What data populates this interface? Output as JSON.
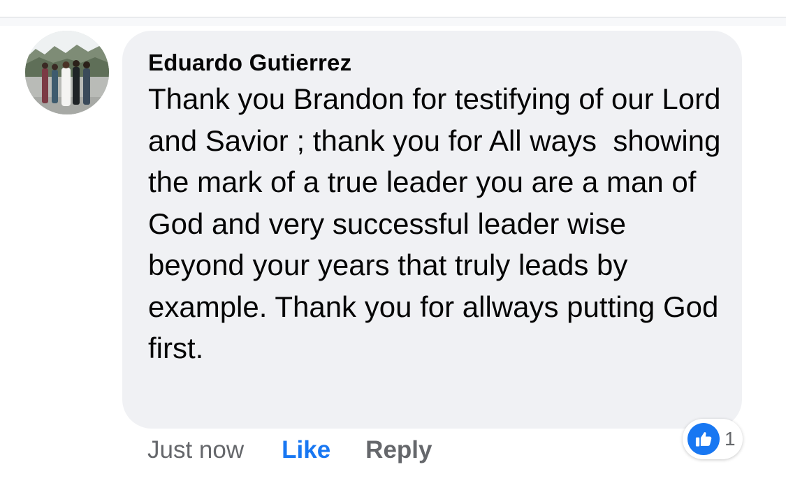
{
  "comment": {
    "author": "Eduardo Gutierrez",
    "text": "Thank you Brandon for testifying of our Lord and Savior ; thank you for All ways  showing the mark of a true leader you are a man of God and very successful leader wise beyond your years that truly leads by example. Thank you for allways putting God first.",
    "avatar_icon": "profile-photo-group"
  },
  "actions": {
    "timestamp": "Just now",
    "like_label": "Like",
    "reply_label": "Reply"
  },
  "reactions": {
    "icon": "thumbs-up-icon",
    "count": "1"
  },
  "colors": {
    "bubble_bg": "#f0f1f4",
    "like_blue": "#1877f2",
    "secondary_text": "#65676b",
    "primary_text": "#050505"
  }
}
